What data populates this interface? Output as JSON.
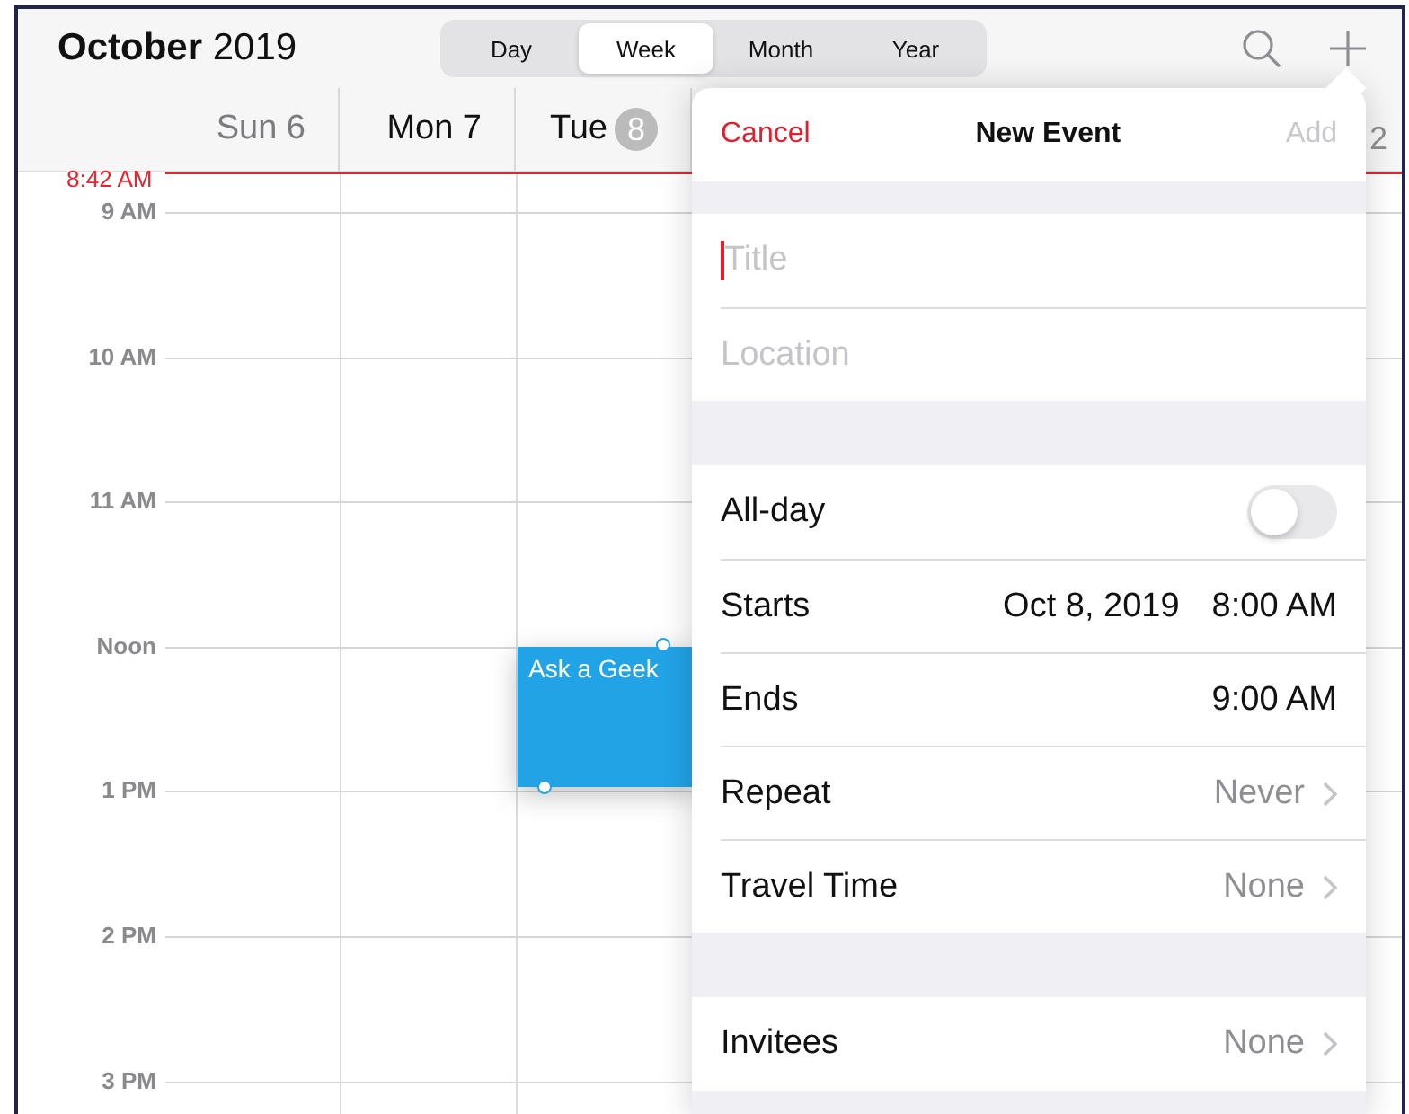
{
  "header": {
    "title": "**October** 2019",
    "view_tabs": [
      {
        "label": "Day",
        "selected": false
      },
      {
        "label": "Week",
        "selected": true
      },
      {
        "label": "Month",
        "selected": false
      },
      {
        "label": "Year",
        "selected": false
      }
    ]
  },
  "days": [
    {
      "label": "Sun 6",
      "weekend": true
    },
    {
      "label": "Mon 7",
      "weekend": false
    },
    {
      "label": "Tue",
      "badge": "8",
      "weekend": false
    }
  ],
  "hidden_day_fragment": "2",
  "current_time": "8:42 AM",
  "hours": [
    "9 AM",
    "10 AM",
    "11 AM",
    "Noon",
    "1 PM",
    "2 PM",
    "3 PM"
  ],
  "events": [
    {
      "title": "Ask a Geek",
      "selected": true
    }
  ],
  "popover": {
    "cancel": "Cancel",
    "title": "New Event",
    "add": "Add",
    "add_disabled": true,
    "sections": [
      {
        "rows": [
          {
            "kind": "field",
            "placeholder": "Title",
            "focused": true
          },
          {
            "kind": "field",
            "placeholder": "Location",
            "focused": false
          }
        ]
      },
      {
        "rows": [
          {
            "kind": "toggle",
            "label": "All-day",
            "on": false
          },
          {
            "kind": "value",
            "label": "Starts",
            "values": [
              "Oct 8, 2019",
              "8:00 AM"
            ]
          },
          {
            "kind": "value",
            "label": "Ends",
            "values": [
              "9:00 AM"
            ]
          },
          {
            "kind": "disclosure",
            "label": "Repeat",
            "value": "Never"
          },
          {
            "kind": "disclosure",
            "label": "Travel Time",
            "value": "None"
          }
        ]
      },
      {
        "rows": [
          {
            "kind": "disclosure",
            "label": "Invitees",
            "value": "None"
          }
        ]
      }
    ]
  }
}
